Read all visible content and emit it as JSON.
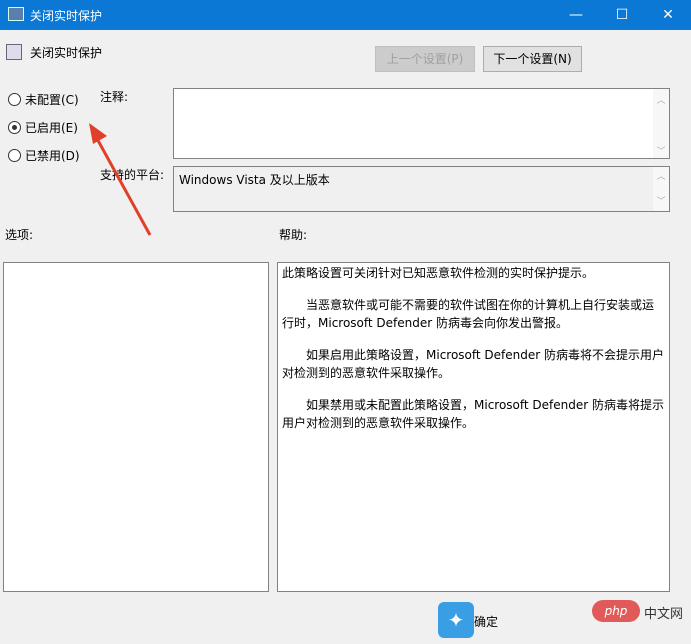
{
  "window": {
    "title": "关闭实时保护",
    "minimize": "—",
    "maximize": "☐",
    "close": "✕"
  },
  "header": {
    "policy_name": "关闭实时保护",
    "prev_button": "上一个设置(P)",
    "next_button": "下一个设置(N)"
  },
  "state": {
    "options": [
      {
        "label": "未配置(C)",
        "checked": false
      },
      {
        "label": "已启用(E)",
        "checked": true
      },
      {
        "label": "已禁用(D)",
        "checked": false
      }
    ]
  },
  "comment": {
    "label": "注释:",
    "value": ""
  },
  "platform": {
    "label": "支持的平台:",
    "value": "Windows Vista 及以上版本"
  },
  "options_label": "选项:",
  "help_label": "帮助:",
  "help": [
    "此策略设置可关闭针对已知恶意软件检测的实时保护提示。",
    "当恶意软件或可能不需要的软件试图在你的计算机上自行安装或运行时，Microsoft Defender 防病毒会向你发出警报。",
    "如果启用此策略设置，Microsoft Defender 防病毒将不会提示用户对检测到的恶意软件采取操作。",
    "如果禁用或未配置此策略设置，Microsoft Defender 防病毒将提示用户对检测到的恶意软件采取操作。"
  ],
  "footer": {
    "ok_button": "确定"
  },
  "watermark": {
    "text": "php中文网"
  }
}
